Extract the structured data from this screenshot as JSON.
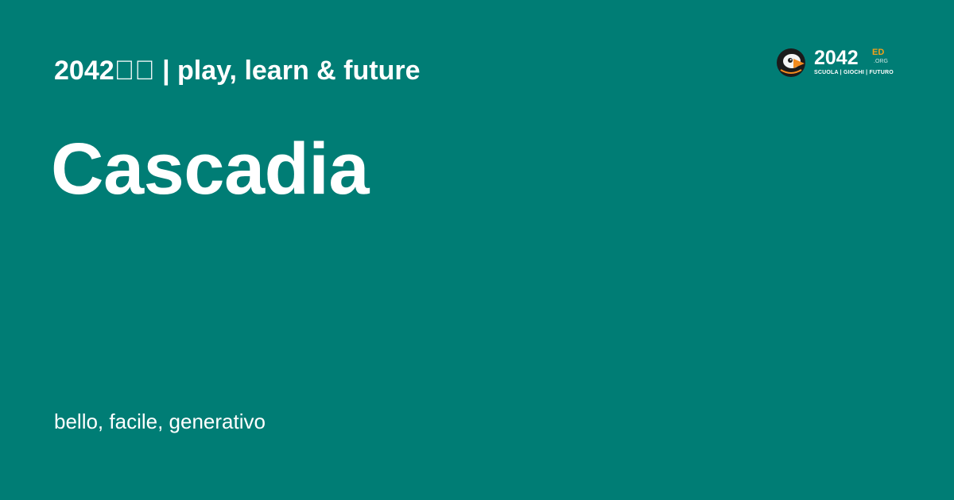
{
  "header": {
    "site_line": "2042\u0000\u0000 | play, learn & future"
  },
  "main": {
    "title": "Cascadia",
    "tagline": "bello, facile, generativo"
  },
  "logo": {
    "number": "2042",
    "suffix": "ED",
    "domain": ".ORG",
    "subtitle": "SCUOLA | GIOCHI | FUTURO",
    "icon": "puffin-mascot-icon"
  },
  "colors": {
    "background": "#007d75",
    "text": "#ffffff",
    "accent": "#f4a11a"
  }
}
